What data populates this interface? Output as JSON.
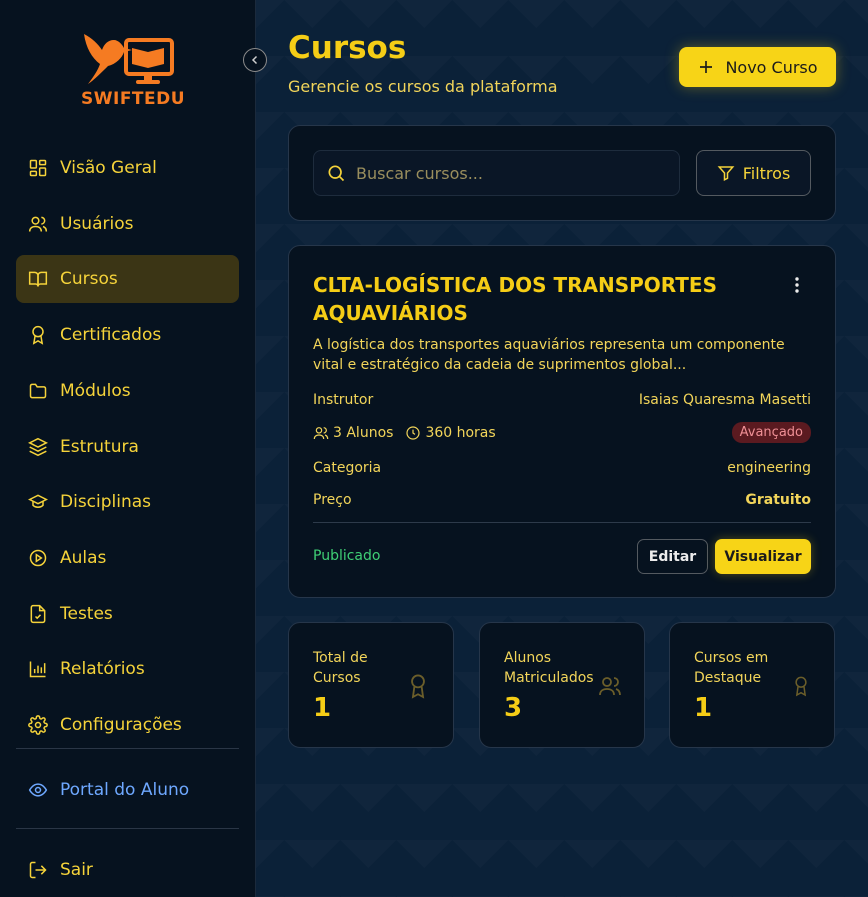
{
  "brand": {
    "name": "SWIFTEDU"
  },
  "sidebar": {
    "items": [
      {
        "label": "Visão Geral",
        "icon": "grid-icon"
      },
      {
        "label": "Usuários",
        "icon": "users-icon"
      },
      {
        "label": "Cursos",
        "icon": "book-icon",
        "active": true
      },
      {
        "label": "Certificados",
        "icon": "award-icon"
      },
      {
        "label": "Módulos",
        "icon": "folder-icon"
      },
      {
        "label": "Estrutura",
        "icon": "layers-icon"
      },
      {
        "label": "Disciplinas",
        "icon": "graduation-cap-icon"
      },
      {
        "label": "Aulas",
        "icon": "play-circle-icon"
      },
      {
        "label": "Testes",
        "icon": "file-check-icon"
      },
      {
        "label": "Relatórios",
        "icon": "bar-chart-icon"
      },
      {
        "label": "Configurações",
        "icon": "gear-icon"
      }
    ],
    "portal": {
      "label": "Portal do Aluno",
      "icon": "eye-icon"
    },
    "logout": {
      "label": "Sair",
      "icon": "logout-icon"
    }
  },
  "header": {
    "title": "Cursos",
    "subtitle": "Gerencie os cursos da plataforma",
    "new_button": "Novo Curso"
  },
  "search": {
    "placeholder": "Buscar cursos...",
    "filters_label": "Filtros"
  },
  "course": {
    "title": "CLTA-LOGÍSTICA DOS TRANSPORTES AQUAVIÁRIOS",
    "description": "A logística dos transportes aquaviários representa um componente vital e estratégico da cadeia de suprimentos global...",
    "instructor_label": "Instrutor",
    "instructor": "Isaias Quaresma Masetti",
    "students": "3 Alunos",
    "hours": "360 horas",
    "level": "Avançado",
    "category_label": "Categoria",
    "category": "engineering",
    "price_label": "Preço",
    "price": "Gratuito",
    "status": "Publicado",
    "edit_label": "Editar",
    "view_label": "Visualizar"
  },
  "stats": [
    {
      "label": "Total de Cursos",
      "value": "1",
      "icon": "award-icon"
    },
    {
      "label": "Alunos Matriculados",
      "value": "3",
      "icon": "users-icon"
    },
    {
      "label": "Cursos em Destaque",
      "value": "1",
      "icon": "award-icon"
    }
  ],
  "colors": {
    "accent": "#f7d417",
    "brand": "#f57b22",
    "success": "#3fcf75",
    "link": "#6ea8ff"
  }
}
